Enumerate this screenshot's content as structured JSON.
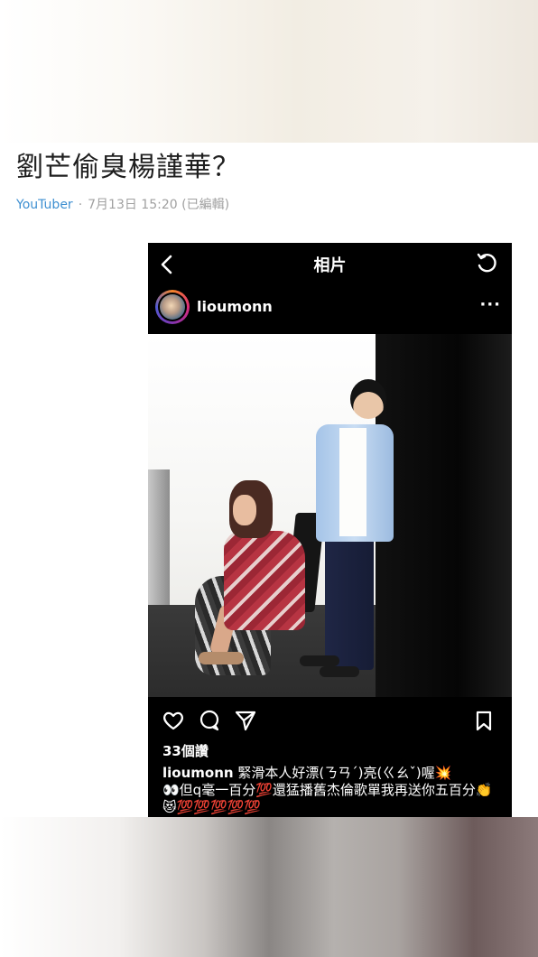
{
  "article": {
    "title": "劉芒偷臭楊謹華？",
    "author": "YouTuber",
    "separator": "·",
    "date": "7月13日 15:20 (已編輯)"
  },
  "instagram": {
    "nav_title": "相片",
    "username": "lioumonn",
    "more": "···",
    "likes": "33個讚",
    "caption_user": "lioumonn",
    "caption_text": " 緊滑本人好漂(ㄋㄢˊ)亮(ㄍㄠˇ)喔💥\n👀但q毫一百分💯還猛播舊杰倫歌單我再送你五百分👏😻💯💯💯💯💯"
  },
  "icons": [
    "back-icon",
    "refresh-icon",
    "heart-icon",
    "comment-icon",
    "share-icon",
    "bookmark-icon"
  ]
}
